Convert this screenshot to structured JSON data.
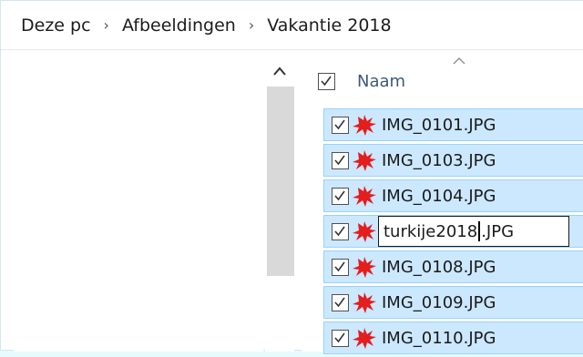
{
  "breadcrumb": [
    "Deze pc",
    "Afbeeldingen",
    "Vakantie 2018"
  ],
  "header": {
    "column_name": "Naam"
  },
  "files": [
    {
      "name": "IMG_0101.JPG",
      "checked": true
    },
    {
      "name": "IMG_0103.JPG",
      "checked": true
    },
    {
      "name": "IMG_0104.JPG",
      "checked": true
    },
    {
      "rename_before": "turkije2018",
      "rename_after": ".JPG",
      "checked": true
    },
    {
      "name": "IMG_0108.JPG",
      "checked": true
    },
    {
      "name": "IMG_0109.JPG",
      "checked": true
    },
    {
      "name": "IMG_0110.JPG",
      "checked": true
    }
  ],
  "colors": {
    "selection": "#cce8ff",
    "selection_border": "#99d1ff",
    "icon_red": "#e41d1d"
  },
  "icons": {
    "file": "red-splash-icon",
    "sort": "chevron-up-icon",
    "scroll_up": "chevron-up-icon"
  }
}
